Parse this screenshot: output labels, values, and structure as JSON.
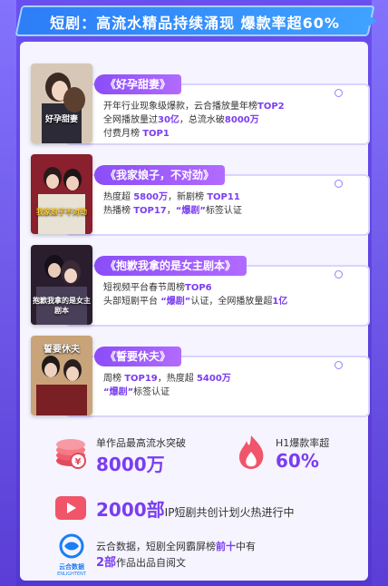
{
  "banner": {
    "title": "短剧：高流水精品持续涌现  爆款率超60%"
  },
  "cards": [
    {
      "tag": "《好孕甜妻》",
      "poster_text": "好孕甜妻",
      "line1": "开年行业现象级爆款，云合播放量年榜",
      "line1_hl": "TOP2",
      "line2a": "全网播放量过",
      "line2_hl1": "30亿",
      "line2b": "，总流水破",
      "line2_hl2": "8000万",
      "line3a": "付费月榜",
      "line3_hl": "TOP1"
    },
    {
      "tag": "《我家娘子，不对劲》",
      "poster_text": "我家娘子不对劲",
      "line1a": "热度超",
      "line1_hl1": "5800万",
      "line1b": "，新剧榜",
      "line1_hl2": "TOP11",
      "line2a": "热播榜",
      "line2_hl": "TOP17",
      "line2b": "，",
      "line2_hl2": "“爆剧”",
      "line2c": "标签认证"
    },
    {
      "tag": "《抱歉我拿的是女主剧本》",
      "poster_text": "抱歉我拿的是女主剧本",
      "line1a": "短视频平台春节周榜",
      "line1_hl": "TOP6",
      "line2a": "头部短剧平台",
      "line2_hl": "“爆剧”",
      "line2b": "认证，全网播放量超",
      "line2_hl2": "1亿"
    },
    {
      "tag": "《誓要休夫》",
      "poster_text": "誓要休夫",
      "line1a": "周榜",
      "line1_hl1": "TOP19",
      "line1b": "，热度超",
      "line1_hl2": "5400万",
      "line2_hl": "“爆剧”",
      "line2b": "标签认证"
    }
  ],
  "stats": {
    "coins_label": "单作品最高流水突破",
    "coins_value": "8000万",
    "fire_label": "H1爆款率超",
    "fire_value": "60%",
    "ip_value": "2000部",
    "ip_label": "IP短剧共创计划火热进行中",
    "logo_cn": "云合数据",
    "logo_en": "ENLIGHTENT",
    "yunhe_line1a": "云合数据，短剧全网霸屏榜",
    "yunhe_line1_hl": "前十",
    "yunhe_line1b": "中有",
    "yunhe_line2_hl": "2部",
    "yunhe_line2b": "作品出品自阅文"
  },
  "colors": {
    "accent": "#7a3df0",
    "banner": "#2d7df7",
    "bg": "#5b3fd6"
  },
  "icons": [
    "coins-icon",
    "fire-icon",
    "play-icon",
    "yunhe-logo"
  ]
}
